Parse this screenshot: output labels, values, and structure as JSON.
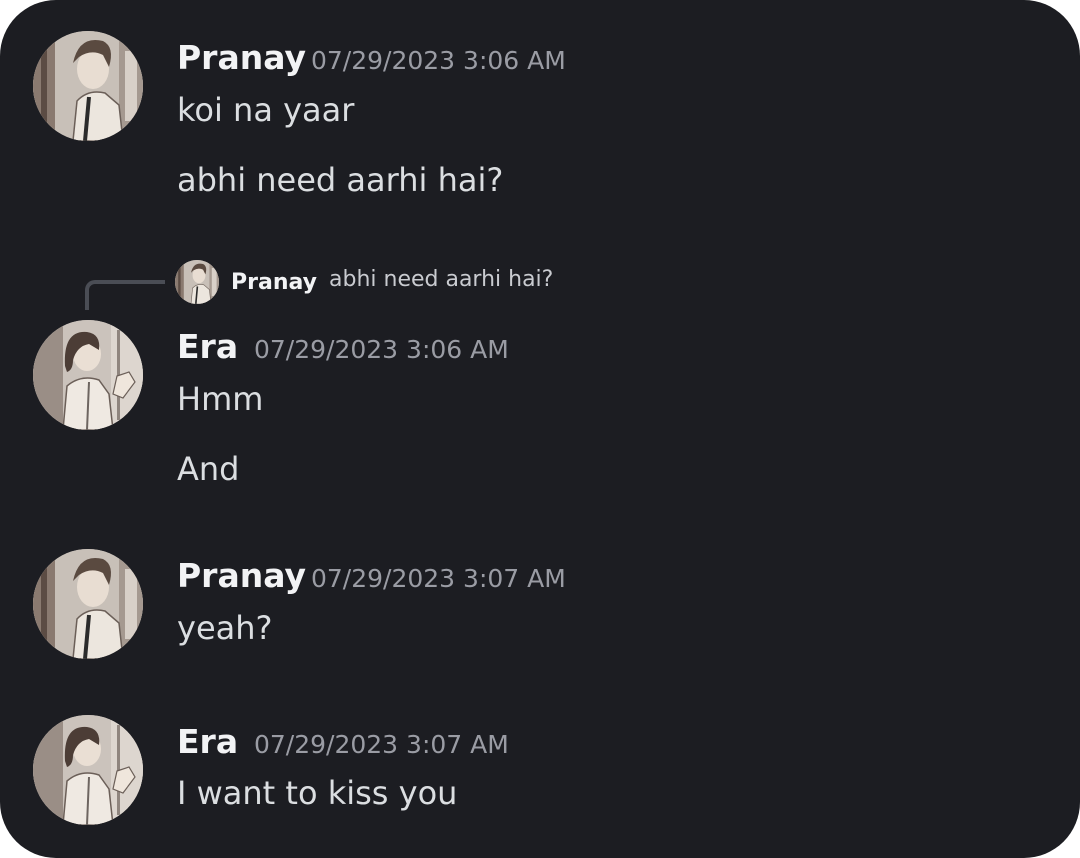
{
  "messages": [
    {
      "author": "Pranay",
      "timestamp": "07/29/2023 3:06 AM",
      "avatar_icon": "pranay-avatar-illustration",
      "lines": [
        "koi na yaar",
        "abhi need aarhi hai?"
      ]
    },
    {
      "author": "Era",
      "timestamp": "07/29/2023 3:06 AM",
      "avatar_icon": "era-avatar-illustration",
      "reply_to": {
        "author": "Pranay",
        "text": "abhi need aarhi hai?"
      },
      "lines": [
        "Hmm",
        "And"
      ]
    },
    {
      "author": "Pranay",
      "timestamp": "07/29/2023 3:07 AM",
      "avatar_icon": "pranay-avatar-illustration",
      "lines": [
        "yeah?"
      ]
    },
    {
      "author": "Era",
      "timestamp": "07/29/2023 3:07 AM",
      "avatar_icon": "era-avatar-illustration",
      "lines": [
        "I want to kiss you"
      ]
    }
  ],
  "colors": {
    "background": "#1c1d22",
    "author_name": "#f2f3f5",
    "timestamp": "#9a9ca4",
    "message_text": "#dbdee1",
    "reply_connector": "#4a4d55"
  }
}
